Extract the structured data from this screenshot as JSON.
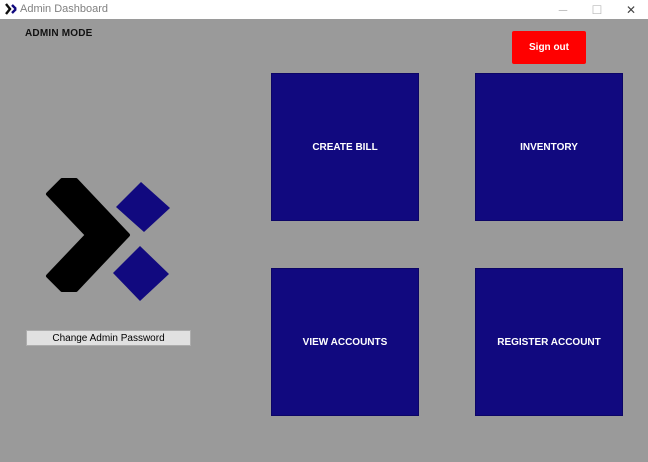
{
  "window": {
    "title": "Admin Dashboard",
    "app_icon": "x-logo-icon",
    "controls": {
      "minimize": "─",
      "maximize": "☐",
      "close": "✕"
    }
  },
  "header": {
    "mode_label": "ADMIN MODE",
    "sign_out_label": "Sign out",
    "sign_out_color": "#ff0000"
  },
  "tiles": [
    {
      "label": "CREATE BILL"
    },
    {
      "label": "INVENTORY"
    },
    {
      "label": "VIEW ACCOUNTS"
    },
    {
      "label": "REGISTER ACCOUNT"
    }
  ],
  "tile_color": "#11097f",
  "sidebar": {
    "logo": "x-logo",
    "change_password_label": "Change Admin Password"
  }
}
